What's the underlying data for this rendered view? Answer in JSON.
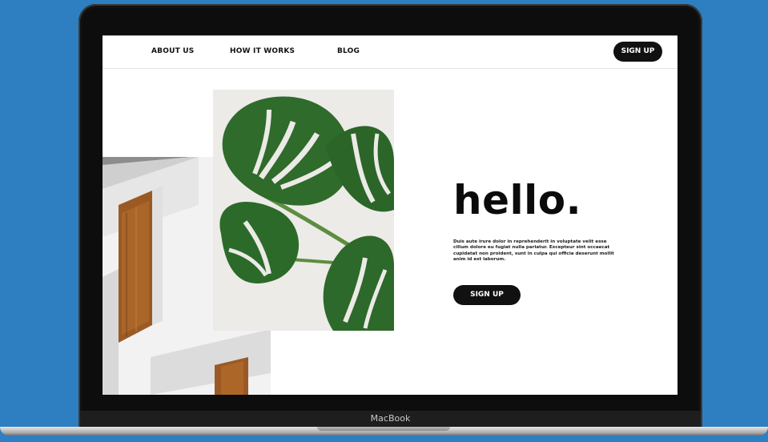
{
  "device": {
    "brand_label": "MacBook"
  },
  "nav": {
    "links": [
      "ABOUT US",
      "HOW IT WORKS",
      "BLOG"
    ],
    "signup_label": "SIGN UP"
  },
  "hero": {
    "title": "hello.",
    "body": "Duis aute irure dolor in reprehenderit in voluptate velit esse cillum dolore eu fugiat nulla pariatur. Excepteur sint occaecat cupidatat non proident, sunt in culpa qui officia deserunt mollit anim id est laborum.",
    "cta_label": "SIGN UP"
  },
  "colors": {
    "background": "#2e7fc2",
    "button": "#111111",
    "leaf": "#2f6b2b",
    "wood": "#9b5a24"
  }
}
